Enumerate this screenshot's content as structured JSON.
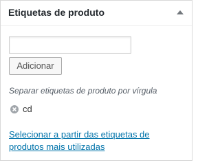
{
  "panel": {
    "title": "Etiquetas de produto",
    "toggle_icon": "triangle-up-icon"
  },
  "tag_input": {
    "value": "",
    "placeholder": ""
  },
  "add_button": {
    "label": "Adicionar"
  },
  "hint": "Separar etiquetas de produto por vírgula",
  "tags": [
    {
      "label": "cd",
      "remove_icon": "remove-circle-icon"
    }
  ],
  "most_used_link": "Selecionar a partir das etiquetas de produtos mais utilizadas",
  "colors": {
    "link": "#0073aa",
    "title": "#23282d",
    "border": "#d8d8d8"
  }
}
